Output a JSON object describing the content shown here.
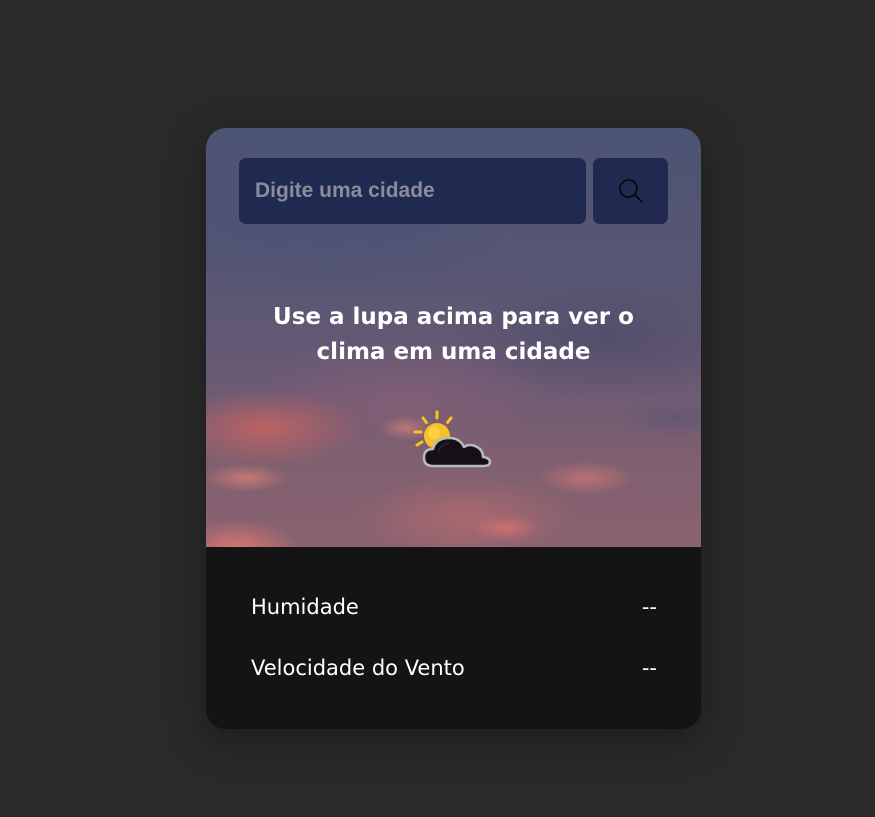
{
  "search": {
    "placeholder": "Digite uma cidade",
    "value": "",
    "button_icon": "search-icon"
  },
  "main": {
    "headline": "Use a lupa acima para ver o clima em uma cidade",
    "weather_icon": "sun-behind-cloud-icon"
  },
  "stats": [
    {
      "label": "Humidade",
      "value": "--"
    },
    {
      "label": "Velocidade do Vento",
      "value": "--"
    }
  ],
  "colors": {
    "page_background": "#2a2a2a",
    "panel_background": "#141414",
    "input_background": "#162048",
    "text": "#ffffff"
  }
}
